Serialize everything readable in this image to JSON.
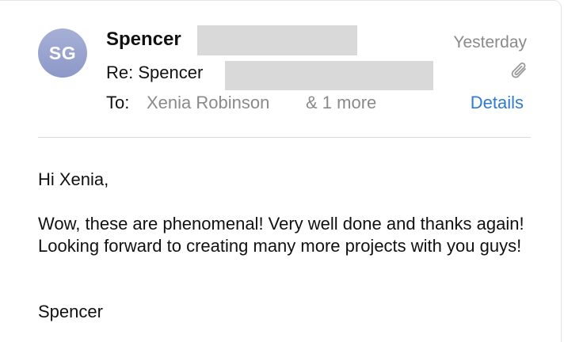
{
  "header": {
    "avatar_initials": "SG",
    "sender_name": "Spencer",
    "subject_prefix": "Re: Spencer",
    "to_label": "To:",
    "to_name": "Xenia Robinson",
    "to_more": "& 1 more",
    "date": "Yesterday",
    "details_label": "Details",
    "attachment_icon": "paperclip-icon"
  },
  "body": {
    "greeting": "Hi Xenia,",
    "message": "Wow, these are phenomenal! Very well done and thanks again! Looking forward to creating many more projects with you guys!",
    "signoff": "Spencer"
  },
  "colors": {
    "avatar": "#9aa3d0",
    "link": "#2f7ad6",
    "muted": "#8a8a8a",
    "redaction": "#d9d9d9"
  }
}
